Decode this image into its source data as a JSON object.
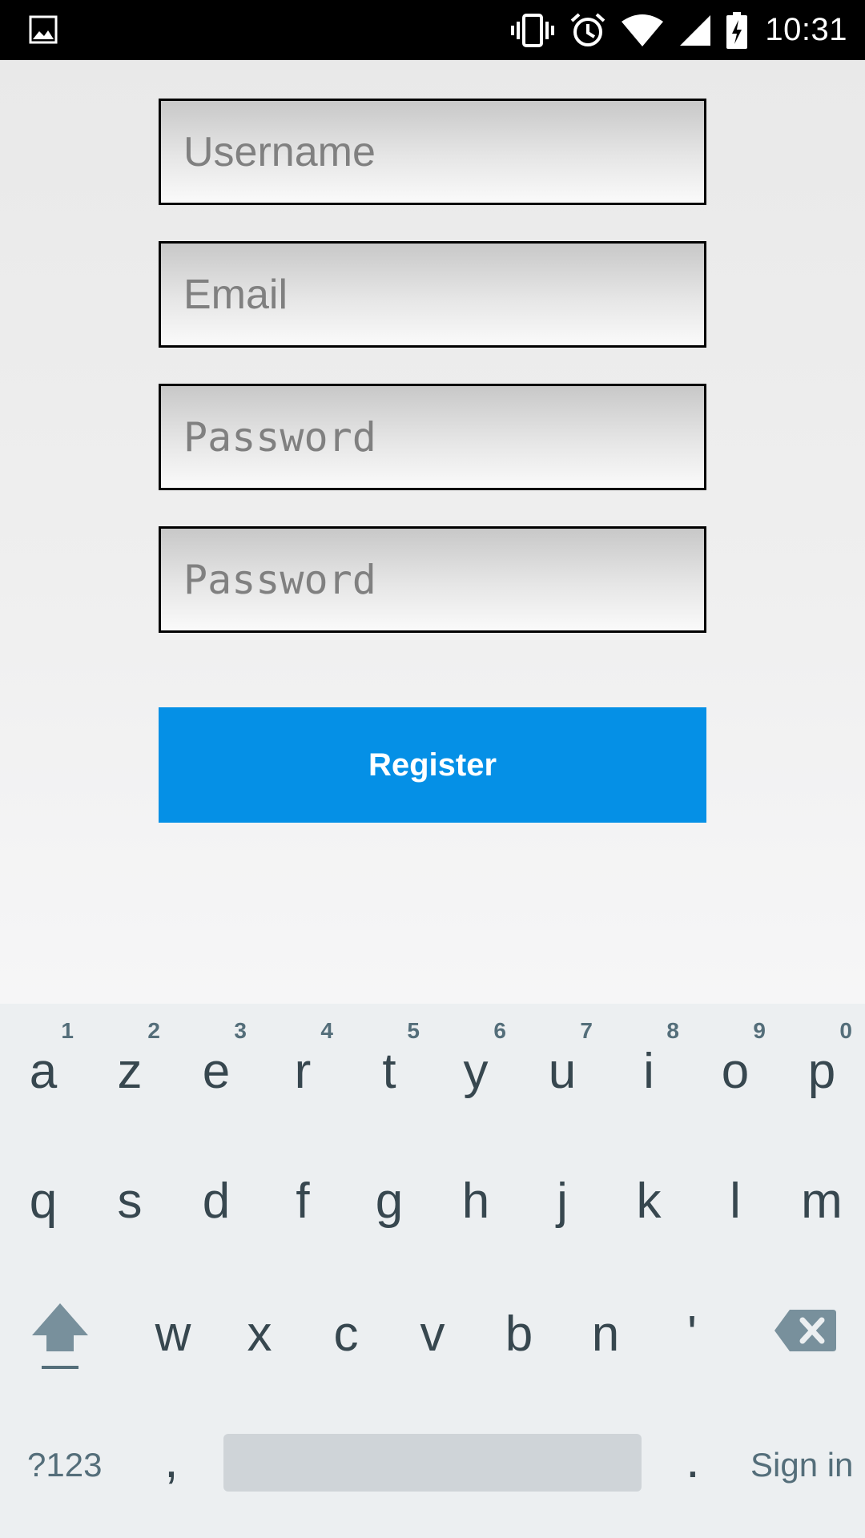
{
  "status_bar": {
    "time": "10:31",
    "icons": [
      "image-icon",
      "vibrate-icon",
      "alarm-icon",
      "wifi-icon",
      "signal-icon",
      "battery-charging-icon"
    ]
  },
  "form": {
    "username_placeholder": "Username",
    "email_placeholder": "Email",
    "password_placeholder": "Password",
    "confirm_password_placeholder": "Password",
    "register_label": "Register",
    "register_color": "#0590e6"
  },
  "keyboard": {
    "row1": [
      {
        "key": "a",
        "hint": "1"
      },
      {
        "key": "z",
        "hint": "2"
      },
      {
        "key": "e",
        "hint": "3"
      },
      {
        "key": "r",
        "hint": "4"
      },
      {
        "key": "t",
        "hint": "5"
      },
      {
        "key": "y",
        "hint": "6"
      },
      {
        "key": "u",
        "hint": "7"
      },
      {
        "key": "i",
        "hint": "8"
      },
      {
        "key": "o",
        "hint": "9"
      },
      {
        "key": "p",
        "hint": "0"
      }
    ],
    "row2": [
      "q",
      "s",
      "d",
      "f",
      "g",
      "h",
      "j",
      "k",
      "l",
      "m"
    ],
    "row3": [
      "w",
      "x",
      "c",
      "v",
      "b",
      "n",
      "'"
    ],
    "symbols_label": "?123",
    "comma": ",",
    "period": ".",
    "action_label": "Sign in",
    "shift_icon": "shift-icon",
    "backspace_icon": "backspace-icon"
  }
}
